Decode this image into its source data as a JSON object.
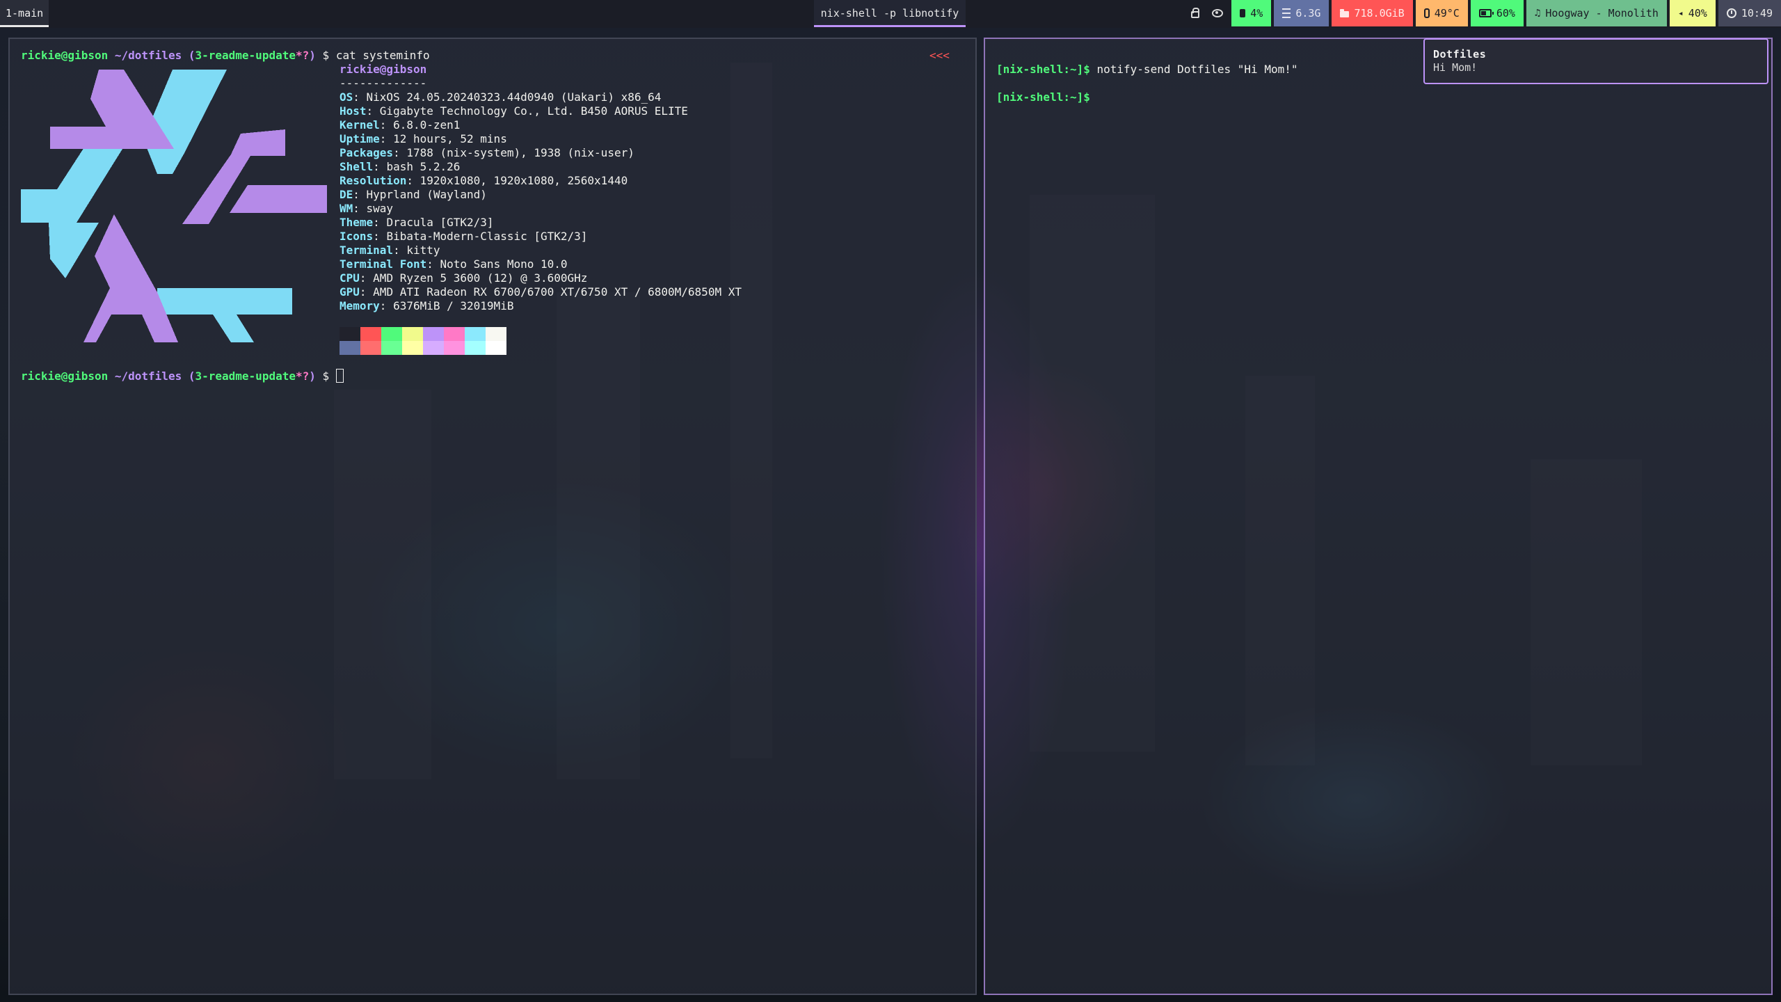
{
  "topbar": {
    "workspace": "1-main",
    "window_title": "nix-shell -p libnotify",
    "modules": [
      {
        "id": "lock",
        "icon": "lock-icon",
        "text": "",
        "bg": "",
        "fg": "#d8d8d8"
      },
      {
        "id": "idle",
        "icon": "eye-icon",
        "text": "",
        "bg": "",
        "fg": "#d8d8d8"
      },
      {
        "id": "cpu",
        "icon": "chip-icon",
        "text": "4%",
        "bg": "#50fa7b",
        "fg": "#1b1d26"
      },
      {
        "id": "memory",
        "icon": "memory-icon",
        "text": "6.3G",
        "bg": "#6272a4",
        "fg": "#e6e6f0"
      },
      {
        "id": "disk",
        "icon": "folder-icon",
        "text": "718.0GiB",
        "bg": "#ff5555",
        "fg": "#ffe8e8"
      },
      {
        "id": "temperature",
        "icon": "thermometer-icon",
        "text": "49°C",
        "bg": "#ffb86c",
        "fg": "#1b1d26"
      },
      {
        "id": "battery",
        "icon": "battery-icon",
        "text": "60%",
        "bg": "#50fa7b",
        "fg": "#1b1d26"
      },
      {
        "id": "media",
        "icon": "music-note-icon",
        "text": "Hoogway - Monolith",
        "bg": "#6fbf8e",
        "fg": "#1b1d26"
      },
      {
        "id": "volume",
        "icon": "speaker-icon",
        "text": "40%",
        "bg": "#f1fa8c",
        "fg": "#1b1d26"
      },
      {
        "id": "clock",
        "icon": "clock-icon",
        "text": "10:49",
        "bg": "#44475a",
        "fg": "#e8e8e8"
      }
    ]
  },
  "left_terminal": {
    "prompt_user": "rickie@gibson",
    "prompt_path": "~/dotfiles",
    "prompt_open": "(",
    "prompt_branch": "3-readme-update",
    "prompt_dirty": "*?",
    "prompt_close": ")",
    "prompt_symbol": "$",
    "command": "cat systeminfo",
    "right_marker": "<<<",
    "user_host": "rickie@gibson",
    "separator": "-------------",
    "info": [
      {
        "key": "OS",
        "value": "NixOS 24.05.20240323.44d0940 (Uakari) x86_64"
      },
      {
        "key": "Host",
        "value": "Gigabyte Technology Co., Ltd. B450 AORUS ELITE"
      },
      {
        "key": "Kernel",
        "value": "6.8.0-zen1"
      },
      {
        "key": "Uptime",
        "value": "12 hours, 52 mins"
      },
      {
        "key": "Packages",
        "value": "1788 (nix-system), 1938 (nix-user)"
      },
      {
        "key": "Shell",
        "value": "bash 5.2.26"
      },
      {
        "key": "Resolution",
        "value": "1920x1080, 1920x1080, 2560x1440"
      },
      {
        "key": "DE",
        "value": "Hyprland (Wayland)"
      },
      {
        "key": "WM",
        "value": "sway"
      },
      {
        "key": "Theme",
        "value": "Dracula [GTK2/3]"
      },
      {
        "key": "Icons",
        "value": "Bibata-Modern-Classic [GTK2/3]"
      },
      {
        "key": "Terminal",
        "value": "kitty"
      },
      {
        "key": "Terminal Font",
        "value": "Noto Sans Mono 10.0"
      },
      {
        "key": "CPU",
        "value": "AMD Ryzen 5 3600 (12) @ 3.600GHz"
      },
      {
        "key": "GPU",
        "value": "AMD ATI Radeon RX 6700/6700 XT/6750 XT / 6800M/6850M XT"
      },
      {
        "key": "Memory",
        "value": "6376MiB / 32019MiB"
      }
    ],
    "palette_top": [
      "#21222c",
      "#ff5555",
      "#50fa7b",
      "#f1fa8c",
      "#bd93f9",
      "#ff79c6",
      "#8be9fd",
      "#f8f8f2"
    ],
    "palette_bottom": [
      "#6272a4",
      "#ff6e6e",
      "#69ff94",
      "#ffffa5",
      "#d6acff",
      "#ff92df",
      "#a4ffff",
      "#ffffff"
    ]
  },
  "right_terminal": {
    "prompt": "[nix-shell:~]$",
    "command": "notify-send Dotfiles \"Hi Mom!\"",
    "prompt2": "[nix-shell:~]$"
  },
  "notification": {
    "title": "Dotfiles",
    "body": "Hi Mom!"
  },
  "logo_colors": {
    "cyan": "#7fdbf5",
    "purple": "#b58ae8"
  }
}
